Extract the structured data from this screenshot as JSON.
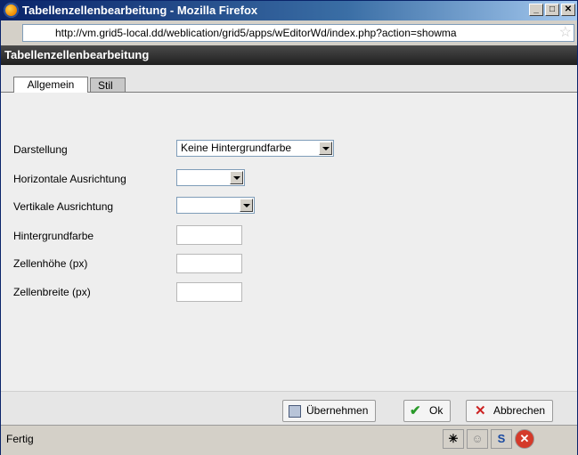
{
  "window": {
    "title": "Tabellenzellenbearbeitung - Mozilla Firefox"
  },
  "urlbar": {
    "url": "http://vm.grid5-local.dd/weblication/grid5/apps/wEditorWd/index.php?action=showma"
  },
  "dialog": {
    "title": "Tabellenzellenbearbeitung"
  },
  "tabs": [
    {
      "label": "Allgemein"
    },
    {
      "label": "Stil"
    }
  ],
  "form": {
    "darstellung": {
      "label": "Darstellung",
      "value": "Keine Hintergrundfarbe"
    },
    "horizontal": {
      "label": "Horizontale Ausrichtung",
      "value": ""
    },
    "vertikal": {
      "label": "Vertikale Ausrichtung",
      "value": ""
    },
    "hintergrundfarbe": {
      "label": "Hintergrundfarbe",
      "value": ""
    },
    "zellenhoehe": {
      "label": "Zellenhöhe (px)",
      "value": ""
    },
    "zellenbreite": {
      "label": "Zellenbreite (px)",
      "value": ""
    }
  },
  "buttons": {
    "apply": "Übernehmen",
    "ok": "Ok",
    "cancel": "Abbrechen"
  },
  "status": {
    "text": "Fertig"
  },
  "colors": {
    "accent": "#0a246a",
    "ok_green": "#2a9a2a",
    "cancel_red": "#cc2222"
  }
}
